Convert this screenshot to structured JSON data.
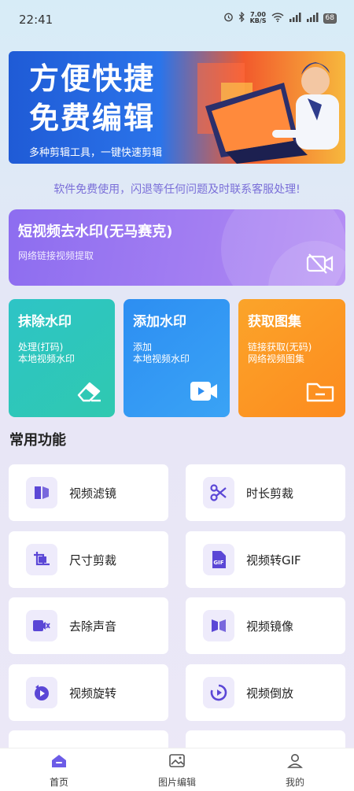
{
  "status": {
    "time": "22:41",
    "speed_top": "7.00",
    "speed_unit": "KB/S",
    "battery": "68"
  },
  "banner": {
    "title_line1": "方便快捷",
    "title_line2": "免费编辑",
    "subtitle": "多种剪辑工具，一键快速剪辑"
  },
  "notice": "软件免费使用，闪退等任何问题及时联系客服处理!",
  "main_card": {
    "title": "短视频去水印(无马赛克)",
    "subtitle": "网络链接视频提取"
  },
  "cards": [
    {
      "title": "抹除水印",
      "line1": "处理(打码)",
      "line2": "本地视频水印"
    },
    {
      "title": "添加水印",
      "line1": "添加",
      "line2": "本地视频水印"
    },
    {
      "title": "获取图集",
      "line1": "链接获取(无码)",
      "line2": "网络视频图集"
    }
  ],
  "section_title": "常用功能",
  "features": [
    {
      "label": "视频滤镜",
      "icon": "filter-icon"
    },
    {
      "label": "时长剪裁",
      "icon": "scissors-icon"
    },
    {
      "label": "尺寸剪裁",
      "icon": "crop-icon"
    },
    {
      "label": "视频转GIF",
      "icon": "gif-icon"
    },
    {
      "label": "去除声音",
      "icon": "mute-icon"
    },
    {
      "label": "视频镜像",
      "icon": "mirror-icon"
    },
    {
      "label": "视频旋转",
      "icon": "rotate-icon"
    },
    {
      "label": "视频倒放",
      "icon": "reverse-play-icon"
    }
  ],
  "nav": [
    {
      "label": "首页",
      "icon": "home-icon"
    },
    {
      "label": "图片编辑",
      "icon": "image-edit-icon"
    },
    {
      "label": "我的",
      "icon": "profile-icon"
    }
  ],
  "colors": {
    "accent": "#6c5ce7",
    "notice": "#7a6fd8"
  }
}
